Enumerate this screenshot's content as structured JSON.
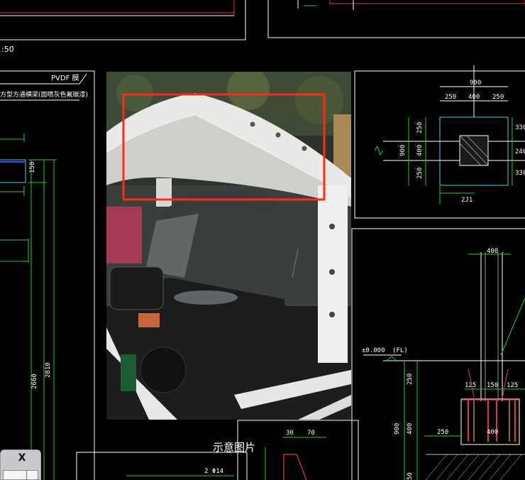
{
  "labels": {
    "scale": ":50",
    "material": "PVDF 膜",
    "beam_note": "方型方通横梁(面喷灰色氟碳漆)",
    "caption": "示意图片",
    "column_tag": "2J1",
    "elevation": "±0.000",
    "elevation_fl": "(FL)",
    "rebar": "2 Φ14"
  },
  "dimensions": {
    "plan_total": "900",
    "plan_a": "250",
    "plan_b": "400",
    "plan_c": "250",
    "left_v1": "250",
    "left_v2": "400",
    "left_v3": "250",
    "left_total": "900",
    "right_v1": "330",
    "right_v2": "240",
    "right_v3": "330",
    "elev_a": "125",
    "elev_b": "150",
    "elev_c": "125",
    "elev_top": "400",
    "elev_v1": "250",
    "elev_v2": "400",
    "elev_v3": "900",
    "elev_250": "250",
    "elev_400": "400",
    "side_150": "150",
    "height_a": "2660",
    "height_b": "2810",
    "small_30": "30",
    "small_70": "70",
    "small_50": "50"
  },
  "panel": {
    "close_label": "X"
  },
  "colors": {
    "highlight": "#ff2a1a",
    "cad_green": "#1fd11f",
    "cad_cyan": "#34d5e6",
    "cad_red": "#e03a3a"
  }
}
